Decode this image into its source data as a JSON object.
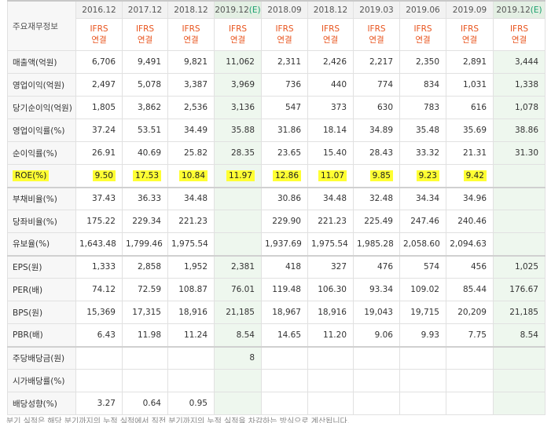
{
  "corner_label": "주요재무정보",
  "periods": [
    {
      "label": "2016.12",
      "est": false
    },
    {
      "label": "2017.12",
      "est": false
    },
    {
      "label": "2018.12",
      "est": false
    },
    {
      "label": "2019.12",
      "est": true
    },
    {
      "label": "2018.09",
      "est": false
    },
    {
      "label": "2018.12",
      "est": false
    },
    {
      "label": "2019.03",
      "est": false
    },
    {
      "label": "2019.06",
      "est": false
    },
    {
      "label": "2019.09",
      "est": false
    },
    {
      "label": "2019.12",
      "est": true
    }
  ],
  "est_marker": "(E)",
  "basis_line1": "IFRS",
  "basis_line2": "연결",
  "rows": [
    {
      "label": "매출액(억원)",
      "values": [
        "6,706",
        "9,491",
        "9,821",
        "11,062",
        "2,311",
        "2,426",
        "2,217",
        "2,350",
        "2,891",
        "3,444"
      ]
    },
    {
      "label": "영업이익(억원)",
      "values": [
        "2,497",
        "5,078",
        "3,387",
        "3,969",
        "736",
        "440",
        "774",
        "834",
        "1,031",
        "1,338"
      ]
    },
    {
      "label": "당기순이익(억원)",
      "values": [
        "1,805",
        "3,862",
        "2,536",
        "3,136",
        "547",
        "373",
        "630",
        "783",
        "616",
        "1,078"
      ]
    },
    {
      "label": "영업이익률(%)",
      "values": [
        "37.24",
        "53.51",
        "34.49",
        "35.88",
        "31.86",
        "18.14",
        "34.89",
        "35.48",
        "35.69",
        "38.86"
      ]
    },
    {
      "label": "순이익률(%)",
      "values": [
        "26.91",
        "40.69",
        "25.82",
        "28.35",
        "23.65",
        "15.40",
        "28.43",
        "33.32",
        "21.31",
        "31.30"
      ]
    },
    {
      "label": "ROE(%)",
      "values": [
        "9.50",
        "17.53",
        "10.84",
        "11.97",
        "12.86",
        "11.07",
        "9.85",
        "9.23",
        "9.42",
        ""
      ],
      "highlight": true
    },
    {
      "label": "부채비율(%)",
      "values": [
        "37.43",
        "36.33",
        "34.48",
        "",
        "30.86",
        "34.48",
        "32.48",
        "34.34",
        "34.96",
        ""
      ]
    },
    {
      "label": "당좌비율(%)",
      "values": [
        "175.22",
        "229.34",
        "221.23",
        "",
        "229.90",
        "221.23",
        "225.49",
        "247.46",
        "240.46",
        ""
      ]
    },
    {
      "label": "유보율(%)",
      "values": [
        "1,643.48",
        "1,799.46",
        "1,975.54",
        "",
        "1,937.69",
        "1,975.54",
        "1,985.28",
        "2,058.60",
        "2,094.63",
        ""
      ]
    },
    {
      "label": "EPS(원)",
      "values": [
        "1,333",
        "2,858",
        "1,952",
        "2,381",
        "418",
        "327",
        "476",
        "574",
        "456",
        "1,025"
      ]
    },
    {
      "label": "PER(배)",
      "values": [
        "74.12",
        "72.59",
        "108.87",
        "76.01",
        "119.48",
        "106.30",
        "93.34",
        "109.02",
        "85.44",
        "176.67"
      ]
    },
    {
      "label": "BPS(원)",
      "values": [
        "15,369",
        "17,315",
        "18,916",
        "21,185",
        "18,967",
        "18,916",
        "19,043",
        "19,715",
        "20,209",
        "21,185"
      ]
    },
    {
      "label": "PBR(배)",
      "values": [
        "6.43",
        "11.98",
        "11.24",
        "8.54",
        "14.65",
        "11.20",
        "9.06",
        "9.93",
        "7.75",
        "8.54"
      ]
    },
    {
      "label": "주당배당금(원)",
      "values": [
        "",
        "",
        "",
        "8",
        "",
        "",
        "",
        "",
        "",
        ""
      ]
    },
    {
      "label": "시가배당률(%)",
      "values": [
        "",
        "",
        "",
        "",
        "",
        "",
        "",
        "",
        "",
        ""
      ]
    },
    {
      "label": "배당성향(%)",
      "values": [
        "3.27",
        "0.64",
        "0.95",
        "",
        "",
        "",
        "",
        "",
        "",
        ""
      ]
    }
  ],
  "footnote": "분기 실적은 해당 분기까지의 누적 실적에서 직전 분기까지의 누적 실적을 차감하는 방식으로 계산됩니다."
}
